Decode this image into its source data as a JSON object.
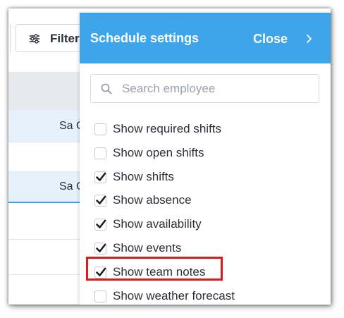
{
  "toolbar": {
    "filter_label": "Filter"
  },
  "schedule": {
    "day_labels": [
      "Sa C",
      "Sa C"
    ]
  },
  "panel": {
    "title": "Schedule settings",
    "close_label": "Close",
    "search": {
      "placeholder": "Search employee",
      "value": ""
    },
    "options": [
      {
        "label": "Show required shifts",
        "checked": false
      },
      {
        "label": "Show open shifts",
        "checked": false
      },
      {
        "label": "Show shifts",
        "checked": true
      },
      {
        "label": "Show absence",
        "checked": true
      },
      {
        "label": "Show availability",
        "checked": true
      },
      {
        "label": "Show events",
        "checked": true
      },
      {
        "label": "Show team notes",
        "checked": true,
        "highlighted": true
      },
      {
        "label": "Show weather forecast",
        "checked": false
      }
    ]
  },
  "colors": {
    "header_blue": "#3ea5ea",
    "highlight_red": "#e0191f",
    "row_blue": "#e5f2fc"
  },
  "icons": {
    "filter": "sliders-icon",
    "search": "search-icon",
    "close": "chevron-right-icon",
    "check": "checkmark-icon"
  }
}
